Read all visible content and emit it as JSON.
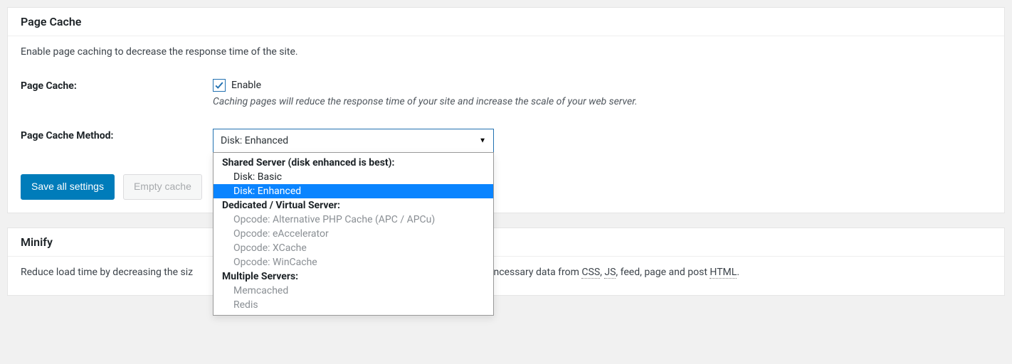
{
  "pageCache": {
    "title": "Page Cache",
    "description": "Enable page caching to decrease the response time of the site.",
    "rows": {
      "enable": {
        "label": "Page Cache:",
        "checkboxLabel": "Enable",
        "checked": true,
        "hint": "Caching pages will reduce the response time of your site and increase the scale of your web server."
      },
      "method": {
        "label": "Page Cache Method:",
        "selected": "Disk: Enhanced",
        "groups": [
          {
            "label": "Shared Server (disk enhanced is best):",
            "options": [
              {
                "label": "Disk: Basic",
                "disabled": false,
                "selected": false
              },
              {
                "label": "Disk: Enhanced",
                "disabled": false,
                "selected": true
              }
            ]
          },
          {
            "label": "Dedicated / Virtual Server:",
            "options": [
              {
                "label": "Opcode: Alternative PHP Cache (APC / APCu)",
                "disabled": true,
                "selected": false
              },
              {
                "label": "Opcode: eAccelerator",
                "disabled": true,
                "selected": false
              },
              {
                "label": "Opcode: XCache",
                "disabled": true,
                "selected": false
              },
              {
                "label": "Opcode: WinCache",
                "disabled": true,
                "selected": false
              }
            ]
          },
          {
            "label": "Multiple Servers:",
            "options": [
              {
                "label": "Memcached",
                "disabled": true,
                "selected": false
              },
              {
                "label": "Redis",
                "disabled": true,
                "selected": false
              }
            ]
          }
        ]
      }
    },
    "buttons": {
      "save": "Save all settings",
      "empty": "Empty cache"
    }
  },
  "minify": {
    "title": "Minify",
    "descPart1": "Reduce load time by decreasing the siz",
    "descPart2": "unncessary data from ",
    "abbr1": "CSS",
    "sep1": ", ",
    "abbr2": "JS",
    "sep2": ", feed, page and post ",
    "abbr3": "HTML",
    "tail": "."
  }
}
